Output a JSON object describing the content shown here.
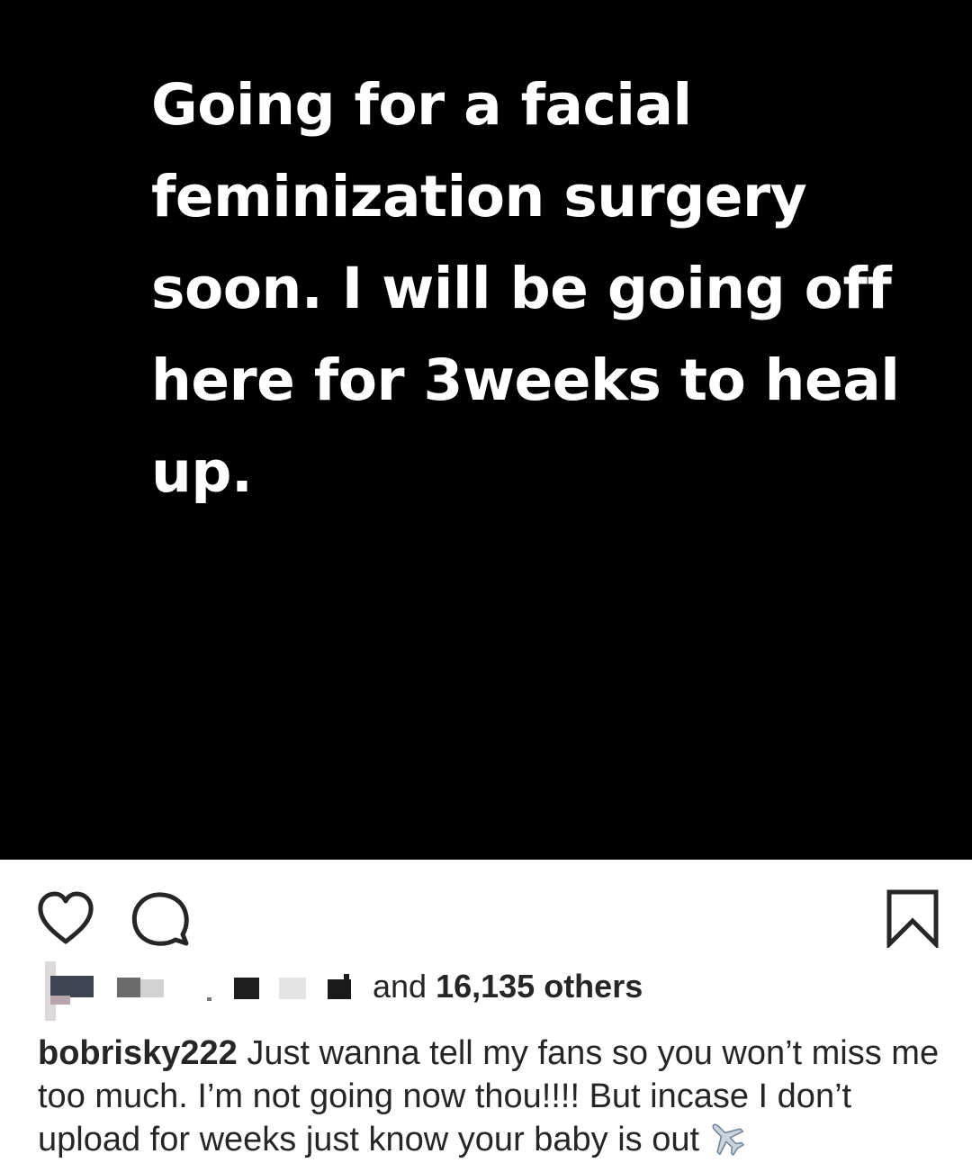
{
  "post": {
    "image_text": "Going for a facial feminization surgery soon. I will be going off here for 3weeks to heal up.",
    "background_color": "#000000",
    "text_color": "#ffffff"
  },
  "actions": {
    "like_icon": "heart-icon",
    "comment_icon": "comment-bubble-icon",
    "save_icon": "bookmark-icon"
  },
  "likes": {
    "prefix": "and",
    "count_text": "16,135 others"
  },
  "caption": {
    "username": "bobrisky222",
    "text": "Just wanna tell my fans so you won’t miss me too much. I’m not going now thou!!!! But incase I don’t upload for weeks just know your baby is out",
    "emoji_icon": "airplane-icon"
  }
}
